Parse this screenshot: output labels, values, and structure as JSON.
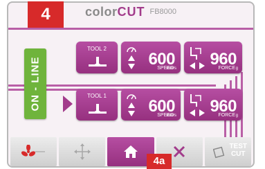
{
  "brand": {
    "name_prefix": "color",
    "name_suffix": "CUT",
    "model": "FB8000"
  },
  "callouts": {
    "main": "4",
    "home": "4a"
  },
  "status": {
    "online_label": "ON - LINE"
  },
  "rows": [
    {
      "tool_label": "TOOL 2",
      "speed_value": "600",
      "speed_unit": "mm/s",
      "speed_label": "SPEED",
      "force_value": "960",
      "force_unit": "g",
      "force_label": "FORCE"
    },
    {
      "tool_label": "TOOL 1",
      "speed_value": "600",
      "speed_unit": "mm/s",
      "speed_label": "SPEED",
      "force_value": "960",
      "force_unit": "g",
      "force_label": "FORCE"
    }
  ],
  "nav": {
    "test_cut_label_1": "TEST",
    "test_cut_label_2": "CUT"
  },
  "colors": {
    "accent": "#a23c8b",
    "online": "#6fb43c",
    "callout": "#d72a2a"
  }
}
